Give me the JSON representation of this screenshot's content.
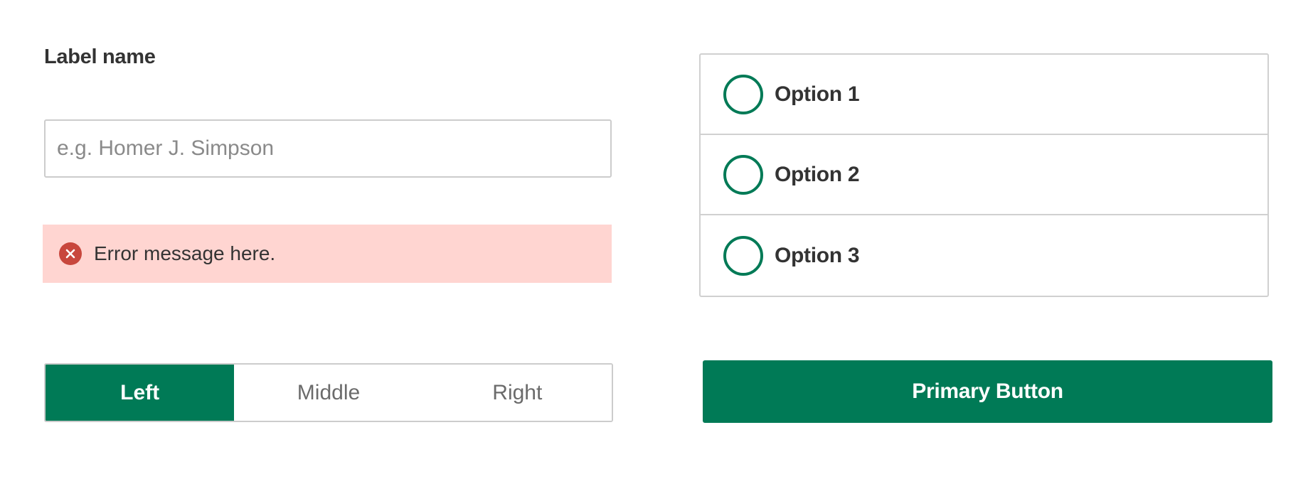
{
  "form": {
    "label": "Label name",
    "input_placeholder": "e.g. Homer J. Simpson",
    "input_value": "",
    "error": {
      "icon": "error-x-circle-icon",
      "message": "Error message here."
    }
  },
  "segmented_control": {
    "segments": [
      {
        "label": "Left",
        "selected": true
      },
      {
        "label": "Middle",
        "selected": false
      },
      {
        "label": "Right",
        "selected": false
      }
    ]
  },
  "radio_group": {
    "options": [
      {
        "label": "Option 1",
        "selected": false
      },
      {
        "label": "Option 2",
        "selected": false
      },
      {
        "label": "Option 3",
        "selected": false
      }
    ]
  },
  "primary_button": {
    "label": "Primary Button"
  },
  "colors": {
    "accent": "#007a56",
    "error_bg": "#ffd5d1",
    "error_icon": "#c8473d",
    "text": "#333333",
    "border": "#cccccc"
  }
}
